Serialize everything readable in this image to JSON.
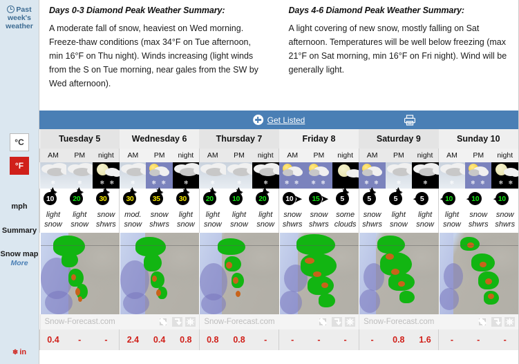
{
  "sidebar": {
    "past_week_line1": "Past",
    "past_week_line2": "week's",
    "past_week_line3": "weather",
    "unit_celsius": "°C",
    "unit_fahrenheit": "°F",
    "wind_unit": "mph",
    "summary_label": "Summary",
    "snow_map_label": "Snow map",
    "more_label": "More",
    "snow_unit": "in",
    "clock_icon": "clock-icon",
    "snowflake_icon": "snowflake-icon"
  },
  "summaries": [
    {
      "title": "Days 0-3 Diamond Peak Weather Summary:",
      "body": "A moderate fall of snow, heaviest on Wed morning. Freeze-thaw conditions (max 34°F on Tue afternoon, min 16°F on Thu night). Winds increasing (light winds from the S on Tue morning, near gales from the SW by Wed afternoon)."
    },
    {
      "title": "Days 4-6 Diamond Peak Weather Summary:",
      "body": "A light covering of new snow, mostly falling on Sat afternoon. Temperatures will be well below freezing (max 21°F on Sat morning, min 16°F on Fri night). Wind will be generally light."
    }
  ],
  "bluebar": {
    "get_listed_label": "Get Listed",
    "plus_icon": "plus-circle-icon",
    "print_icon": "printer-icon",
    "background_color": "#4a7fb5"
  },
  "slot_labels": [
    "AM",
    "PM",
    "night"
  ],
  "days": [
    {
      "name": "Tuesday 5",
      "slots": [
        {
          "slot": "AM",
          "sky": "day-cloud",
          "icon": "cloud-snow-icon",
          "wind": "10",
          "wind_color": "white",
          "dir": "up",
          "text": "light snow",
          "snow": "0.4"
        },
        {
          "slot": "PM",
          "sky": "day-cloud",
          "icon": "cloud-snow-icon",
          "wind": "20",
          "wind_color": "green",
          "dir": "up",
          "text": "light snow",
          "snow": "-"
        },
        {
          "slot": "night",
          "sky": "night",
          "icon": "moon-cloud-snow-icon",
          "wind": "30",
          "wind_color": "yellow",
          "dir": "up",
          "text": "snow shwrs",
          "snow": "-"
        }
      ]
    },
    {
      "name": "Wednesday 6",
      "slots": [
        {
          "slot": "AM",
          "sky": "day-cloud",
          "icon": "cloud-snow-icon",
          "wind": "30",
          "wind_color": "yellow",
          "dir": "up",
          "text": "mod. snow",
          "snow": "2.4"
        },
        {
          "slot": "PM",
          "sky": "day-sun",
          "icon": "sun-cloud-snow-icon",
          "wind": "35",
          "wind_color": "yellow",
          "dir": "up",
          "text": "snow shwrs",
          "snow": "0.4"
        },
        {
          "slot": "night",
          "sky": "night",
          "icon": "cloud-snow-icon",
          "wind": "30",
          "wind_color": "yellow",
          "dir": "up",
          "text": "light snow",
          "snow": "0.8"
        }
      ]
    },
    {
      "name": "Thursday 7",
      "slots": [
        {
          "slot": "AM",
          "sky": "day-cloud",
          "icon": "cloud-snow-icon",
          "wind": "20",
          "wind_color": "green",
          "dir": "up",
          "text": "light snow",
          "snow": "0.8"
        },
        {
          "slot": "PM",
          "sky": "day-cloud",
          "icon": "cloud-snow-icon",
          "wind": "10",
          "wind_color": "green",
          "dir": "up",
          "text": "light snow",
          "snow": "0.8"
        },
        {
          "slot": "night",
          "sky": "night",
          "icon": "cloud-snow-icon",
          "wind": "20",
          "wind_color": "green",
          "dir": "up",
          "text": "light snow",
          "snow": "-"
        }
      ]
    },
    {
      "name": "Friday 8",
      "slots": [
        {
          "slot": "AM",
          "sky": "day-sun",
          "icon": "sun-cloud-snow-icon",
          "wind": "10",
          "wind_color": "white",
          "dir": "right",
          "text": "snow shwrs",
          "snow": "-"
        },
        {
          "slot": "PM",
          "sky": "day-sun",
          "icon": "sun-cloud-snow-icon",
          "wind": "15",
          "wind_color": "green",
          "dir": "right",
          "text": "snow shwrs",
          "snow": "-"
        },
        {
          "slot": "night",
          "sky": "night",
          "icon": "moon-cloud-icon",
          "wind": "5",
          "wind_color": "white",
          "dir": "up",
          "text": "some clouds",
          "snow": "-"
        }
      ]
    },
    {
      "name": "Saturday 9",
      "slots": [
        {
          "slot": "AM",
          "sky": "day-sun",
          "icon": "sun-cloud-snow-icon",
          "wind": "5",
          "wind_color": "white",
          "dir": "up",
          "text": "snow shwrs",
          "snow": "-"
        },
        {
          "slot": "PM",
          "sky": "day-cloud",
          "icon": "cloud-snow-icon",
          "wind": "5",
          "wind_color": "white",
          "dir": "up",
          "text": "light snow",
          "snow": "0.8"
        },
        {
          "slot": "night",
          "sky": "night",
          "icon": "cloud-snow-icon",
          "wind": "5",
          "wind_color": "white",
          "dir": "left",
          "text": "light snow",
          "snow": "1.6"
        }
      ]
    },
    {
      "name": "Sunday 10",
      "slots": [
        {
          "slot": "AM",
          "sky": "day-cloud",
          "icon": "cloud-snow-icon",
          "wind": "10",
          "wind_color": "green",
          "dir": "left",
          "text": "light snow",
          "snow": "-"
        },
        {
          "slot": "PM",
          "sky": "day-sun",
          "icon": "sun-cloud-snow-icon",
          "wind": "10",
          "wind_color": "green",
          "dir": "left",
          "text": "snow shwrs",
          "snow": "-"
        },
        {
          "slot": "night",
          "sky": "night",
          "icon": "moon-cloud-snow-icon",
          "wind": "10",
          "wind_color": "green",
          "dir": "left",
          "text": "snow shwrs",
          "snow": "-"
        }
      ]
    }
  ],
  "maps": {
    "watermark": "Snow-Forecast.com",
    "controls": [
      "resize-icon",
      "download-icon",
      "expand-icon"
    ]
  }
}
